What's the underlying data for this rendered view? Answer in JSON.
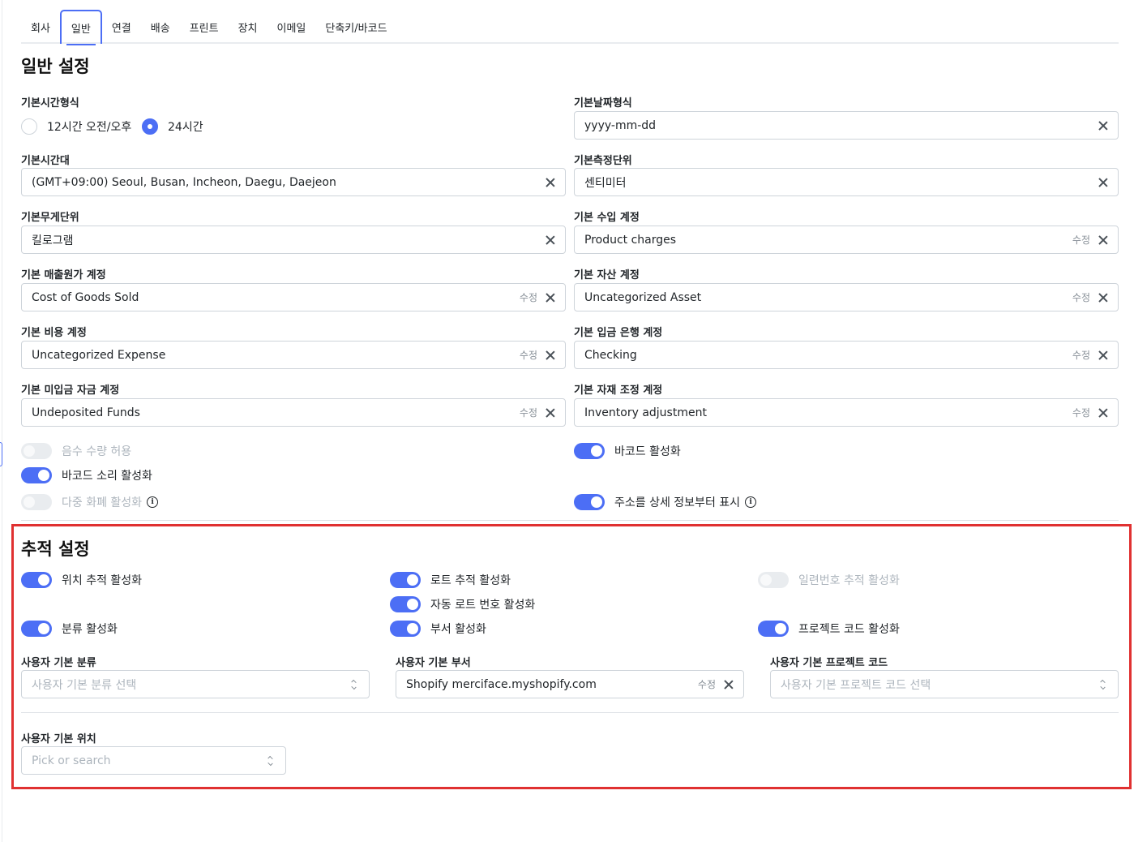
{
  "tabs": [
    "회사",
    "일반",
    "연결",
    "배송",
    "프린트",
    "장치",
    "이메일",
    "단축키/바코드"
  ],
  "general": {
    "title": "일반 설정",
    "time_format": {
      "label": "기본시간형식",
      "options": [
        "12시간 오전/오후",
        "24시간"
      ],
      "selected": "24시간"
    },
    "date_format": {
      "label": "기본날짜형식",
      "value": "yyyy-mm-dd"
    },
    "timezone": {
      "label": "기본시간대",
      "value": "(GMT+09:00) Seoul, Busan, Incheon, Daegu, Daejeon"
    },
    "length_unit": {
      "label": "기본측정단위",
      "value": "센티미터"
    },
    "weight_unit": {
      "label": "기본무게단위",
      "value": "킬로그램"
    },
    "income_account": {
      "label": "기본 수입 계정",
      "value": "Product charges"
    },
    "cogs_account": {
      "label": "기본 매출원가 계정",
      "value": "Cost of Goods Sold"
    },
    "asset_account": {
      "label": "기본 자산 계정",
      "value": "Uncategorized Asset"
    },
    "expense_account": {
      "label": "기본 비용 계정",
      "value": "Uncategorized Expense"
    },
    "deposit_account": {
      "label": "기본 입금 은행 계정",
      "value": "Checking"
    },
    "undeposited_account": {
      "label": "기본 미입금 자금 계정",
      "value": "Undeposited Funds"
    },
    "adjustment_account": {
      "label": "기본 자재 조정 계정",
      "value": "Inventory adjustment"
    },
    "edit_label": "수정",
    "toggles": {
      "negative_qty": {
        "label": "음수 수량 허용",
        "on": false
      },
      "barcode": {
        "label": "바코드 활성화",
        "on": true
      },
      "barcode_sound": {
        "label": "바코드 소리 활성화",
        "on": true
      },
      "multi_currency": {
        "label": "다중 화폐 활성화",
        "on": false
      },
      "address_detail": {
        "label": "주소를 상세 정보부터 표시",
        "on": true
      }
    }
  },
  "tracking": {
    "title": "추적 설정",
    "toggles": {
      "location": {
        "label": "위치 추적 활성화",
        "on": true
      },
      "lot": {
        "label": "로트 추적 활성화",
        "on": true
      },
      "serial": {
        "label": "일련번호 추적 활성화",
        "on": false
      },
      "auto_lot": {
        "label": "자동 로트 번호 활성화",
        "on": true
      },
      "class": {
        "label": "분류 활성화",
        "on": true
      },
      "department": {
        "label": "부서 활성화",
        "on": true
      },
      "project": {
        "label": "프로젝트 코드 활성화",
        "on": true
      }
    },
    "default_class": {
      "label": "사용자 기본 분류",
      "placeholder": "사용자 기본 분류 선택"
    },
    "default_department": {
      "label": "사용자 기본 부서",
      "value": "Shopify merciface.myshopify.com"
    },
    "default_project": {
      "label": "사용자 기본 프로젝트 코드",
      "placeholder": "사용자 기본 프로젝트 코드 선택"
    },
    "default_location": {
      "label": "사용자 기본 위치",
      "placeholder": "Pick or search"
    }
  },
  "colors": {
    "accent": "#4c6ef5",
    "highlight": "#e03131"
  }
}
